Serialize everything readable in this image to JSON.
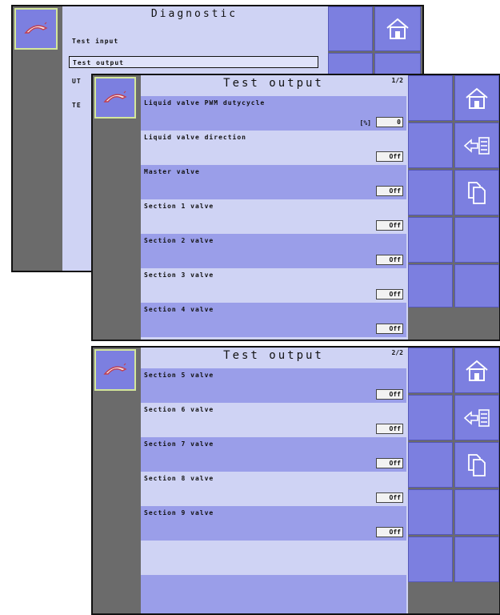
{
  "diagnostic": {
    "title": "Diagnostic",
    "items": [
      "Test input",
      "Test output",
      "UT",
      "TE"
    ]
  },
  "test_output_p1": {
    "title": "Test output",
    "page": "1/2",
    "rows": [
      {
        "label": "Liquid valve PWM dutycycle",
        "unit": "[%]",
        "value": "0"
      },
      {
        "label": "Liquid valve direction",
        "value": "Off"
      },
      {
        "label": "Master valve",
        "value": "Off"
      },
      {
        "label": "Section 1 valve",
        "value": "Off"
      },
      {
        "label": "Section 2 valve",
        "value": "Off"
      },
      {
        "label": "Section 3 valve",
        "value": "Off"
      },
      {
        "label": "Section 4 valve",
        "value": "Off"
      }
    ]
  },
  "test_output_p2": {
    "title": "Test output",
    "page": "2/2",
    "rows": [
      {
        "label": "Section 5 valve",
        "value": "Off"
      },
      {
        "label": "Section 6 valve",
        "value": "Off"
      },
      {
        "label": "Section 7 valve",
        "value": "Off"
      },
      {
        "label": "Section 8 valve",
        "value": "Off"
      },
      {
        "label": "Section 9 valve",
        "value": "Off"
      }
    ]
  },
  "icons": [
    "home-icon",
    "back-list-icon",
    "copy-pages-icon",
    "sprayer-logo-icon"
  ],
  "colors": {
    "panel": "#cfd3f4",
    "row_dark": "#9a9ee9",
    "button": "#7c7fe0",
    "side": "#6b6b6b"
  }
}
